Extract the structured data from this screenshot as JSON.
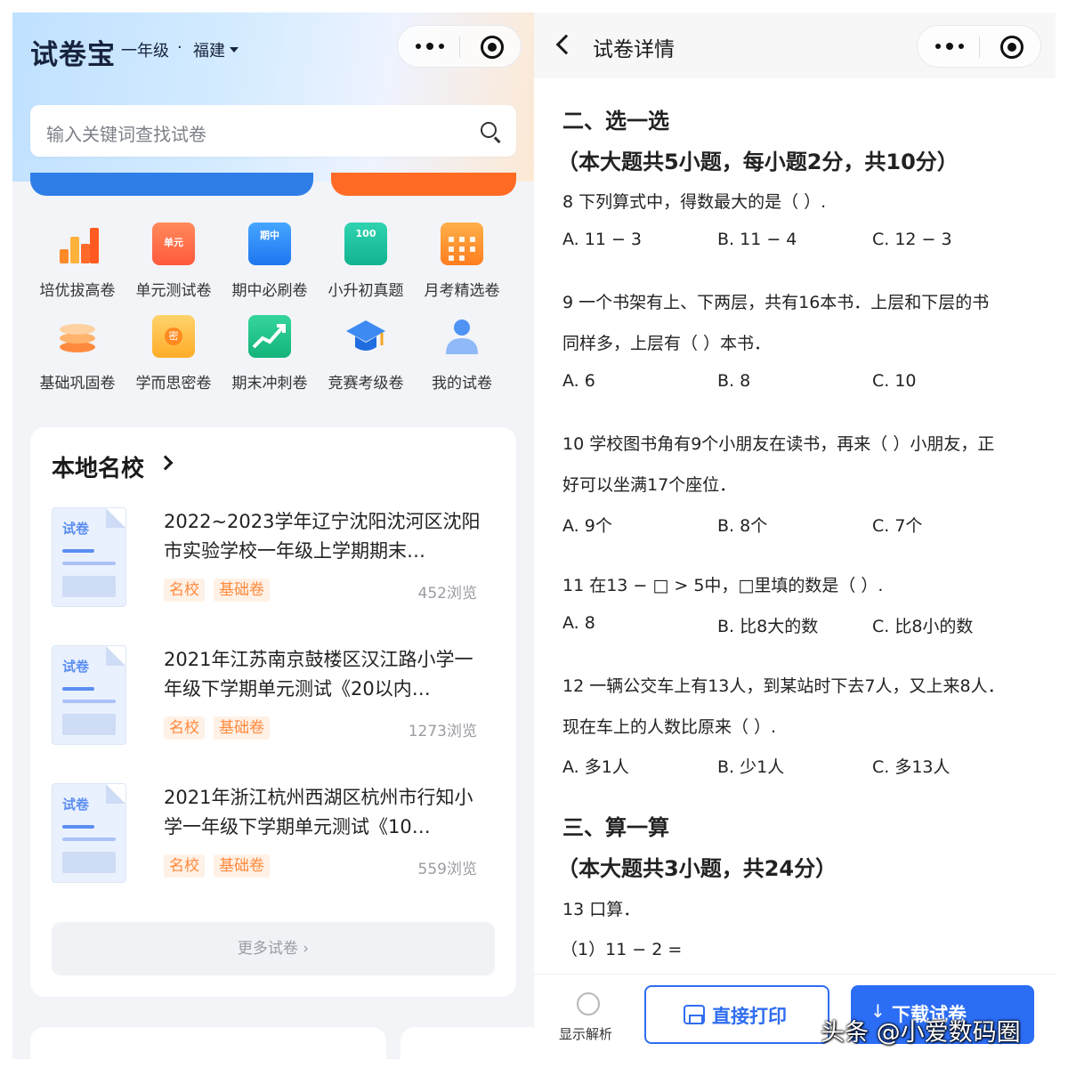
{
  "left": {
    "brand": "试卷宝",
    "grade": "一年级",
    "separator": "·",
    "region": "福建",
    "search_placeholder": "输入关键词查找试卷",
    "categories": [
      {
        "label": "培优拔高卷",
        "icon": "bar-chart-icon"
      },
      {
        "label": "单元测试卷",
        "icon": "unit-test-icon",
        "icon_text": "单元"
      },
      {
        "label": "期中必刷卷",
        "icon": "midterm-icon",
        "icon_text": "期中"
      },
      {
        "label": "小升初真题",
        "icon": "exam-100-icon",
        "icon_text": "100"
      },
      {
        "label": "月考精选卷",
        "icon": "calendar-icon"
      },
      {
        "label": "基础巩固卷",
        "icon": "layers-icon"
      },
      {
        "label": "学而思密卷",
        "icon": "secret-paper-icon",
        "icon_text": "密"
      },
      {
        "label": "期末冲刺卷",
        "icon": "trend-chart-icon"
      },
      {
        "label": "竞赛考级卷",
        "icon": "graduation-cap-icon"
      },
      {
        "label": "我的试卷",
        "icon": "user-icon"
      }
    ],
    "schools": {
      "heading": "本地名校",
      "thumb_tag": "试卷",
      "papers": [
        {
          "title": "2022~2023学年辽宁沈阳沈河区沈阳市实验学校一年级上学期期末…",
          "tags": [
            "名校",
            "基础卷"
          ],
          "views": "452浏览"
        },
        {
          "title": "2021年江苏南京鼓楼区汉江路小学一年级下学期单元测试《20以内…",
          "tags": [
            "名校",
            "基础卷"
          ],
          "views": "1273浏览"
        },
        {
          "title": "2021年浙江杭州西湖区杭州市行知小学一年级下学期单元测试《10…",
          "tags": [
            "名校",
            "基础卷"
          ],
          "views": "559浏览"
        }
      ],
      "more_label": "更多试卷 ›"
    }
  },
  "right": {
    "nav_title": "试卷详情",
    "section2_title": "二、选一选",
    "section2_sub": "（本大题共5小题，每小题2分，共10分）",
    "q8": {
      "text": "8   下列算式中，得数最大的是（   ）.",
      "options": [
        "A.  11 − 3",
        "B.  11 − 4",
        "C.  12 − 3"
      ]
    },
    "q9": {
      "line1": "9   一个书架有上、下两层，共有16本书．上层和下层的书",
      "line2": "同样多，上层有（   ）本书．",
      "options": [
        "A.  6",
        "B.  8",
        "C.  10"
      ]
    },
    "q10": {
      "line1": "10   学校图书角有9个小朋友在读书，再来（   ）小朋友，正",
      "line2": "好可以坐满17个座位．",
      "options": [
        "A.  9个",
        "B.  8个",
        "C.  7个"
      ]
    },
    "q11": {
      "text": "11   在13 − □ > 5中，□里填的数是（   ）.",
      "options": [
        "A.  8",
        "B.  比8大的数",
        "C.  比8小的数"
      ]
    },
    "q12": {
      "line1": "12   一辆公交车上有13人，到某站时下去7人，又上来8人．",
      "line2": "现在车上的人数比原来（   ）.",
      "options": [
        "A.  多1人",
        "B.  少1人",
        "C.  多13人"
      ]
    },
    "section3_title": "三、算一算",
    "section3_sub": "（本大题共3小题，共24分）",
    "q13": {
      "text": "13   口算．",
      "sub1": "（1）11 − 2 ="
    },
    "show_analysis_label": "显示解析",
    "print_label": "直接打印",
    "download_label": "下载试卷"
  },
  "watermark": "头条 @小爱数码圈"
}
